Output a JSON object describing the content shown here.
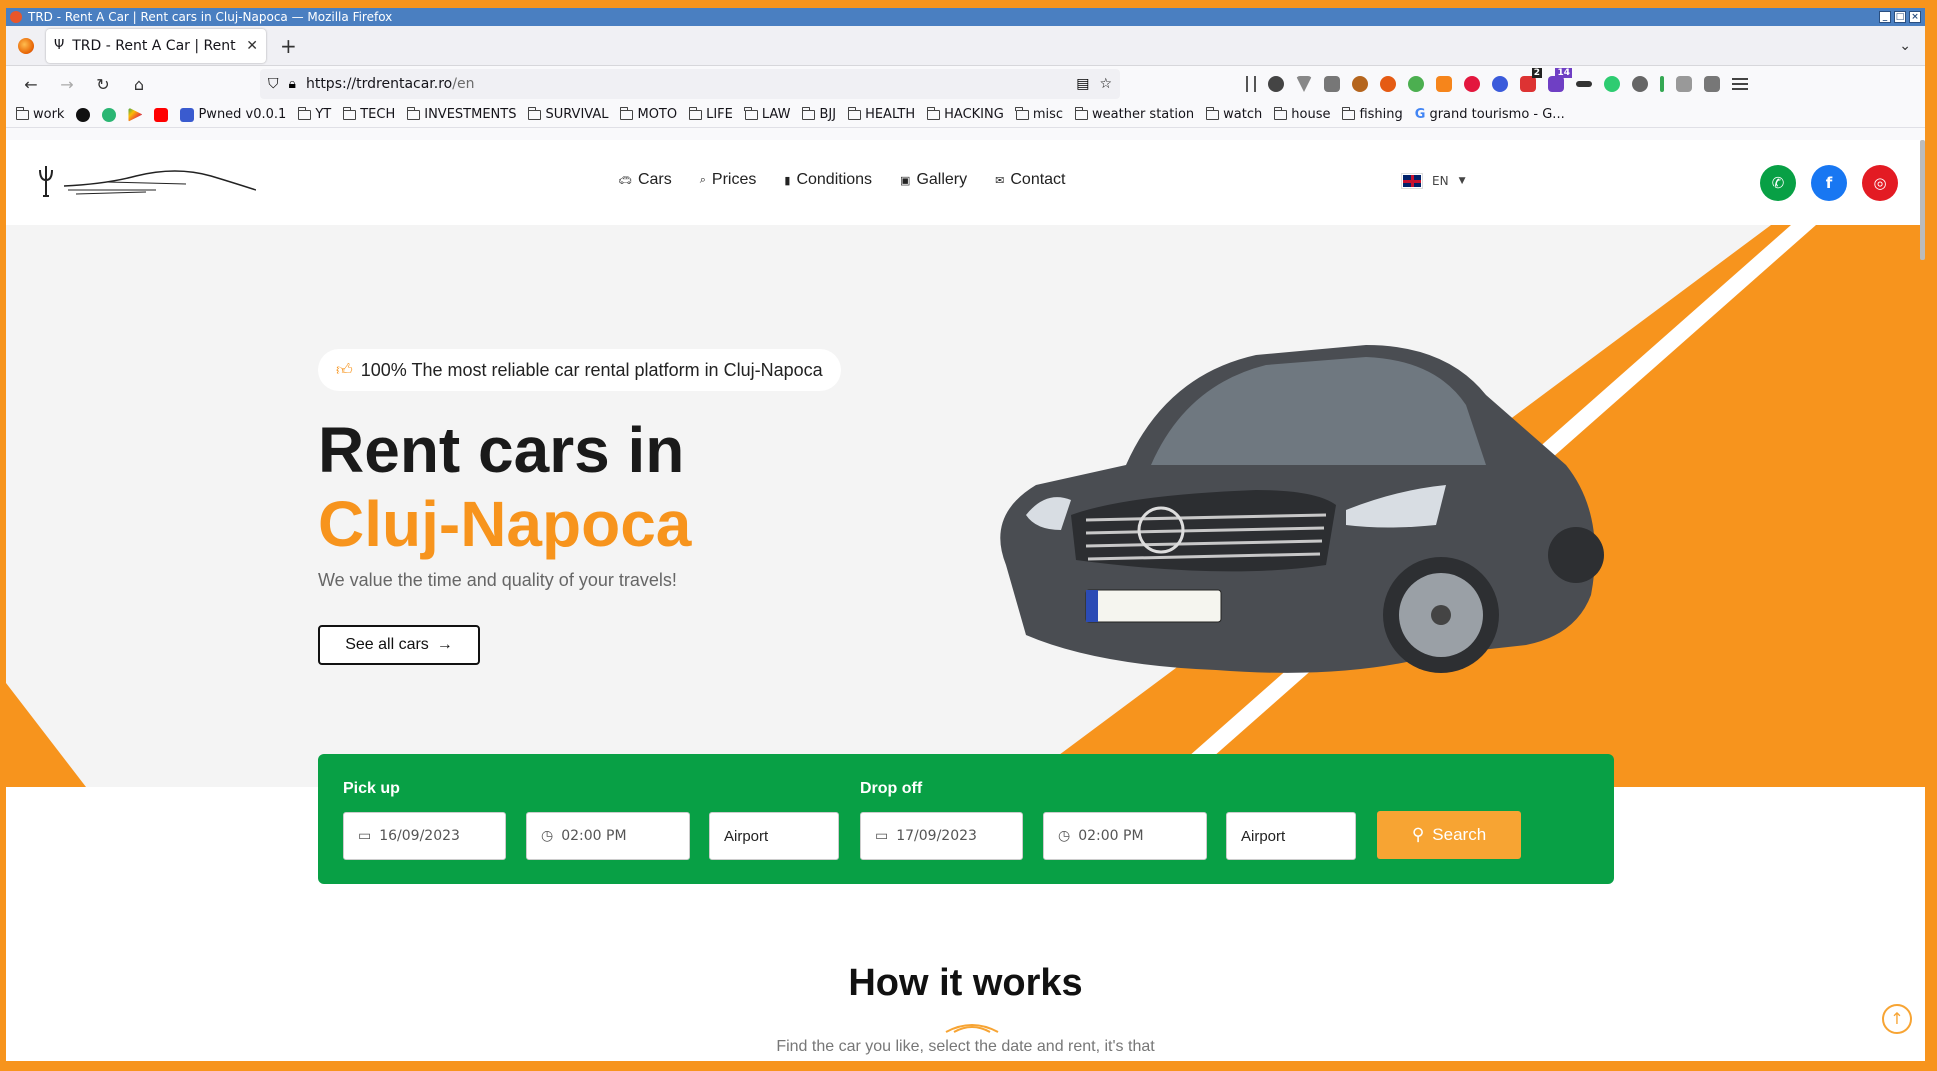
{
  "window": {
    "title": "TRD - Rent A Car | Rent cars in Cluj-Napoca — Mozilla Firefox"
  },
  "tab": {
    "label": "TRD - Rent A Car | Rent c"
  },
  "url": {
    "host": "https://trdrentacar.ro",
    "path": "/en"
  },
  "bookmarks": [
    {
      "label": "work",
      "type": "folder"
    },
    {
      "label": "",
      "type": "github"
    },
    {
      "label": "",
      "type": "site"
    },
    {
      "label": "",
      "type": "play"
    },
    {
      "label": "",
      "type": "youtube"
    },
    {
      "label": "Pwned v0.0.1",
      "type": "site"
    },
    {
      "label": "YT",
      "type": "folder"
    },
    {
      "label": "TECH",
      "type": "folder"
    },
    {
      "label": "INVESTMENTS",
      "type": "folder"
    },
    {
      "label": "SURVIVAL",
      "type": "folder"
    },
    {
      "label": "MOTO",
      "type": "folder"
    },
    {
      "label": "LIFE",
      "type": "folder"
    },
    {
      "label": "LAW",
      "type": "folder"
    },
    {
      "label": "BJJ",
      "type": "folder"
    },
    {
      "label": "HEALTH",
      "type": "folder"
    },
    {
      "label": "HACKING",
      "type": "folder"
    },
    {
      "label": "misc",
      "type": "folder"
    },
    {
      "label": "weather station",
      "type": "folder"
    },
    {
      "label": "watch",
      "type": "folder"
    },
    {
      "label": "house",
      "type": "folder"
    },
    {
      "label": "fishing",
      "type": "folder"
    },
    {
      "label": "grand tourismo - G...",
      "type": "google"
    }
  ],
  "extension_badges": {
    "a": "2",
    "b": "14"
  },
  "nav": {
    "cars": "Cars",
    "prices": "Prices",
    "conditions": "Conditions",
    "gallery": "Gallery",
    "contact": "Contact"
  },
  "lang": {
    "code": "EN"
  },
  "hero": {
    "tagline": "100% The most reliable car rental platform in Cluj-Napoca",
    "title_line1": "Rent cars in",
    "title_line2": "Cluj-Napoca",
    "subtitle": "We value the time and quality of your travels!",
    "cta": "See all cars"
  },
  "booking": {
    "pickup_label": "Pick up",
    "pickup_date": "16/09/2023",
    "pickup_time": "02:00 PM",
    "pickup_location": "Airport",
    "dropoff_label": "Drop off",
    "dropoff_date": "17/09/2023",
    "dropoff_time": "02:00 PM",
    "dropoff_location": "Airport",
    "search": "Search"
  },
  "how": {
    "title": "How it works",
    "subtitle": "Find the car you like, select the date and rent, it's that"
  },
  "colors": {
    "accent": "#f7941d",
    "green": "#08a045",
    "dark": "#1a1a1a"
  }
}
